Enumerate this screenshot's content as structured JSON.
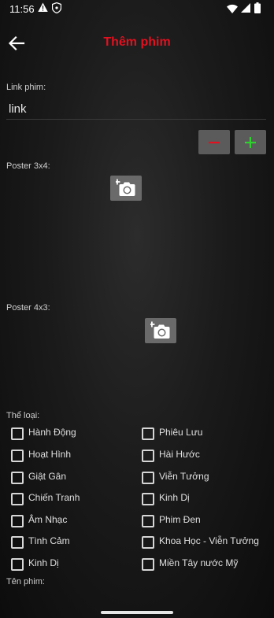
{
  "status_bar": {
    "time": "11:56",
    "icons": [
      "warning-icon",
      "shield-icon",
      "wifi-icon",
      "signal-icon",
      "battery-icon"
    ]
  },
  "app_bar": {
    "back_icon": "arrow-left-icon",
    "title": "Thêm phim",
    "title_color": "#e3101f"
  },
  "form": {
    "link_label": "Link phim:",
    "link_value": "link",
    "minus_icon": "minus-icon",
    "plus_icon": "plus-icon",
    "minus_color": "#e3101f",
    "plus_color": "#2fd12f",
    "poster_3x4_label": "Poster 3x4:",
    "poster_4x3_label": "Poster 4x3:",
    "camera_icon": "add-camera-icon",
    "genre_label": "Thể loại:",
    "genres": [
      "Hành Động",
      "Phiêu Lưu",
      "Hoạt Hình",
      "Hài Hước",
      "Giật Gân",
      "Viễn Tưởng",
      "Chiến Tranh",
      "Kinh Dị",
      "Âm Nhạc",
      "Phim Đen",
      "Tình Cảm",
      "Khoa Học - Viễn Tưởng",
      "Kinh Dị",
      "Miền Tây nước Mỹ"
    ],
    "movie_name_label": "Tên phim:"
  }
}
